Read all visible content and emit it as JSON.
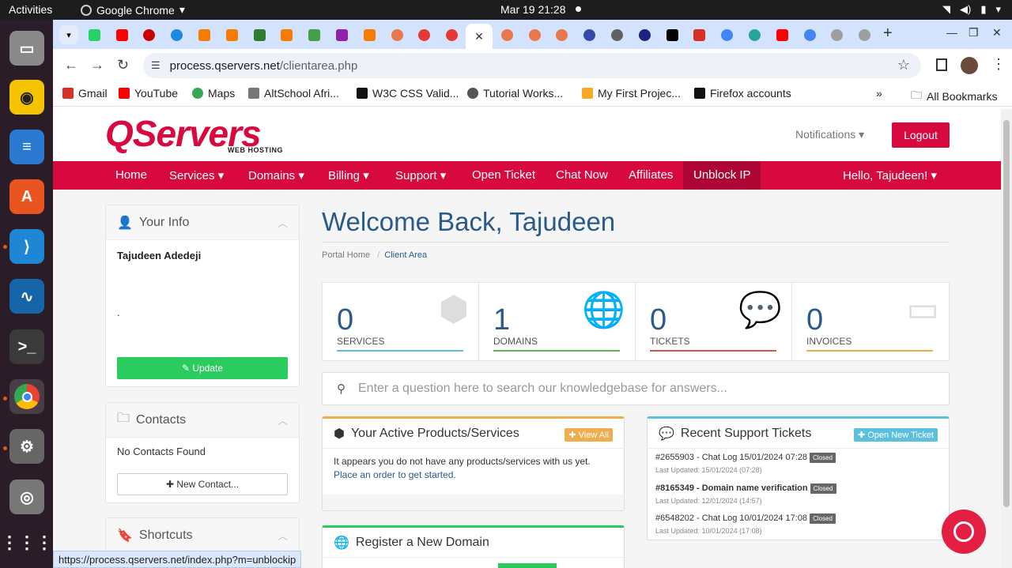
{
  "os": {
    "activities": "Activities",
    "app_name": "Google Chrome",
    "clock": "Mar 19  21:28"
  },
  "browser": {
    "url_host": "process.qservers.net",
    "url_path": "/clientarea.php",
    "status_url": "https://process.qservers.net/index.php?m=unblockip",
    "bookmarks": [
      "Gmail",
      "YouTube",
      "Maps",
      "AltSchool Afri...",
      "W3C CSS Valid...",
      "Tutorial Works...",
      "My First Projec...",
      "Firefox accounts"
    ],
    "all_bookmarks": "All Bookmarks",
    "more": "»"
  },
  "site": {
    "logo": "QServers",
    "logo_sub": "WEB HOSTING",
    "notifications": "Notifications",
    "logout": "Logout",
    "nav": {
      "home": "Home",
      "services": "Services",
      "domains": "Domains",
      "billing": "Billing",
      "support": "Support",
      "open_ticket": "Open Ticket",
      "chat_now": "Chat Now",
      "affiliates": "Affiliates",
      "unblock_ip": "Unblock IP",
      "hello": "Hello, Tajudeen!"
    }
  },
  "sidebar": {
    "your_info": {
      "title": "Your Info",
      "name": "Tajudeen Adedeji",
      "line2": ".",
      "update": "Update"
    },
    "contacts": {
      "title": "Contacts",
      "empty": "No Contacts Found",
      "new": "New Contact..."
    },
    "shortcuts": {
      "title": "Shortcuts"
    }
  },
  "main": {
    "welcome": "Welcome Back, Tajudeen",
    "breadcrumb": {
      "home": "Portal Home",
      "sep": "/",
      "current": "Client Area"
    },
    "tiles": [
      {
        "num": "0",
        "label": "SERVICES",
        "color": "#5bc0de"
      },
      {
        "num": "1",
        "label": "DOMAINS",
        "color": "#5cb85c"
      },
      {
        "num": "0",
        "label": "TICKETS",
        "color": "#d9534f"
      },
      {
        "num": "0",
        "label": "INVOICES",
        "color": "#f0ad4e"
      }
    ],
    "kb_placeholder": "Enter a question here to search our knowledgebase for answers...",
    "products": {
      "title": "Your Active Products/Services",
      "view_all": "View All",
      "text": "It appears you do not have any products/services with us yet.",
      "link": "Place an order to get started."
    },
    "tickets": {
      "title": "Recent Support Tickets",
      "open_new": "Open New Ticket",
      "items": [
        {
          "subject": "#2655903 - Chat Log 15/01/2024 07:28",
          "status": "Closed",
          "updated": "Last Updated: 15/01/2024 (07:28)"
        },
        {
          "subject": "#8165349 - Domain name verification",
          "status": "Closed",
          "updated": "Last Updated: 12/01/2024 (14:57)"
        },
        {
          "subject": "#6548202 - Chat Log 10/01/2024 17:08",
          "status": "Closed",
          "updated": "Last Updated: 10/01/2024 (17:08)"
        }
      ]
    },
    "register": {
      "title": "Register a New Domain"
    }
  }
}
